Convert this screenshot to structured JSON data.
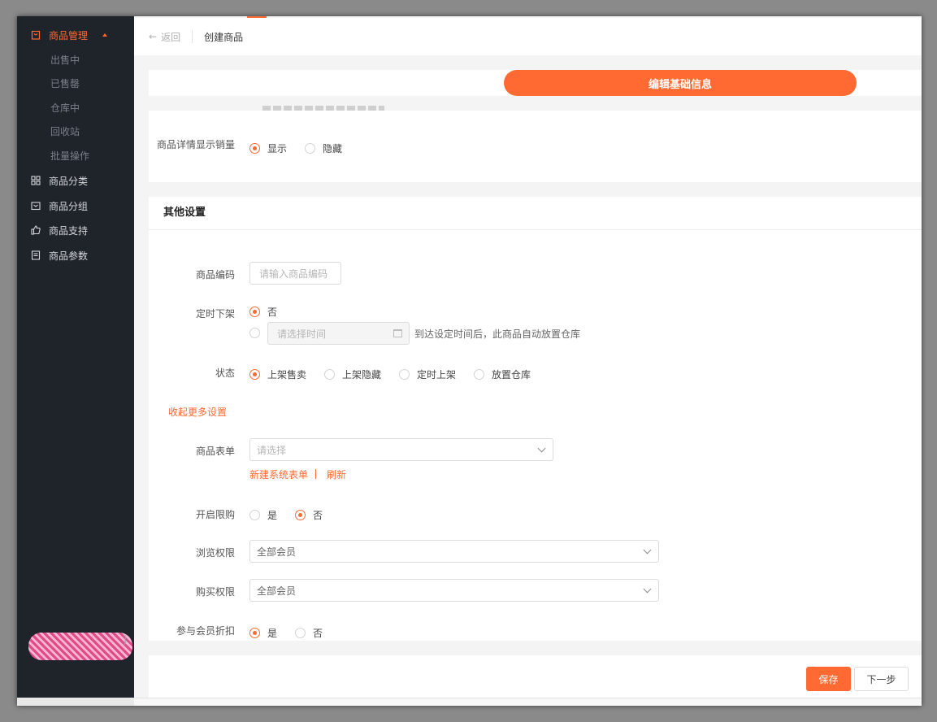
{
  "sidebar": {
    "items": [
      {
        "label": "商品管理",
        "icon": "bag-icon",
        "active": true
      },
      {
        "label": "商品分类",
        "icon": "grid-icon"
      },
      {
        "label": "商品分组",
        "icon": "folder-icon"
      },
      {
        "label": "商品支持",
        "icon": "thumbs-up-icon"
      },
      {
        "label": "商品参数",
        "icon": "document-icon"
      }
    ],
    "subitems": [
      "出售中",
      "已售罄",
      "仓库中",
      "回收站",
      "批量操作"
    ]
  },
  "header": {
    "back_label": "返回",
    "title": "创建商品"
  },
  "steps": {
    "active_label": "编辑基础信息"
  },
  "sales_display": {
    "label": "商品详情显示销量",
    "options": [
      "显示",
      "隐藏"
    ],
    "selected": "显示"
  },
  "other_settings": {
    "title": "其他设置",
    "product_code": {
      "label": "商品编码",
      "placeholder": "请输入商品编码"
    },
    "scheduled_off": {
      "label": "定时下架",
      "option_no": "否",
      "time_placeholder": "请选择时间",
      "hint": "到达设定时间后，此商品自动放置仓库"
    },
    "status": {
      "label": "状态",
      "options": [
        "上架售卖",
        "上架隐藏",
        "定时上架",
        "放置仓库"
      ],
      "selected": "上架售卖"
    },
    "collapse_link": "收起更多设置",
    "product_form": {
      "label": "商品表单",
      "placeholder": "请选择",
      "new_link": "新建系统表单",
      "refresh_link": "刷新"
    },
    "purchase_limit": {
      "label": "开启限购",
      "options": [
        "是",
        "否"
      ],
      "selected": "否"
    },
    "browse_permission": {
      "label": "浏览权限",
      "value": "全部会员"
    },
    "buy_permission": {
      "label": "购买权限",
      "value": "全部会员"
    },
    "member_discount": {
      "label": "参与会员折扣",
      "options": [
        "是",
        "否"
      ],
      "selected": "是"
    }
  },
  "footer": {
    "save_label": "保存",
    "next_label": "下一步"
  },
  "colors": {
    "accent": "#ff6a33",
    "sidebar_bg": "#1f242b"
  }
}
